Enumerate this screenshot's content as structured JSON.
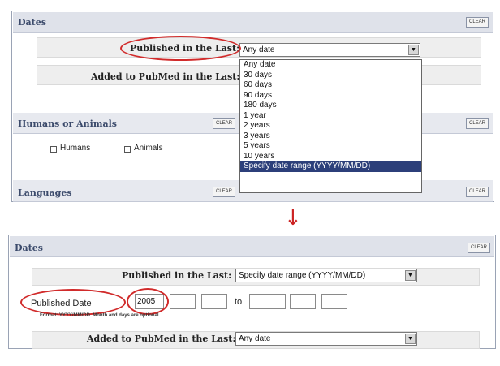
{
  "top": {
    "dates_title": "Dates",
    "clear_label": "CLEAR",
    "published_label": "Published in the Last:",
    "published_value": "Any date",
    "added_label": "Added to PubMed in the Last:",
    "dropdown_options": [
      "Any date",
      "30 days",
      "60 days",
      "90 days",
      "180 days",
      "1 year",
      "2 years",
      "3 years",
      "5 years",
      "10 years",
      "Specify date range (YYYY/MM/DD)"
    ],
    "highlighted_option": "Specify date range (YYYY/MM/DD)",
    "humans_title": "Humans or Animals",
    "humans_label": "Humans",
    "animals_label": "Animals",
    "languages_title": "Languages"
  },
  "arrow": {
    "glyph": "↓",
    "color": "#cc2222"
  },
  "bottom": {
    "dates_title": "Dates",
    "clear_label": "CLEAR",
    "published_label": "Published in the Last:",
    "published_value": "Specify date range (YYYY/MM/DD)",
    "published_date_label": "Published Date",
    "from_year": "2005",
    "from_month": "",
    "from_day": "",
    "to_label": "to",
    "to_year": "",
    "to_month": "",
    "to_day": "",
    "format_hint": "Format: YYYY/MM/DD. Month and days are optional",
    "added_label": "Added to PubMed in the Last:",
    "added_value": "Any date"
  },
  "colors": {
    "highlight_circle": "#d12b2b",
    "selected_option_bg": "#2c3f7a",
    "section_bar": "#dfe2ea",
    "section_title": "#3b4a6b"
  }
}
